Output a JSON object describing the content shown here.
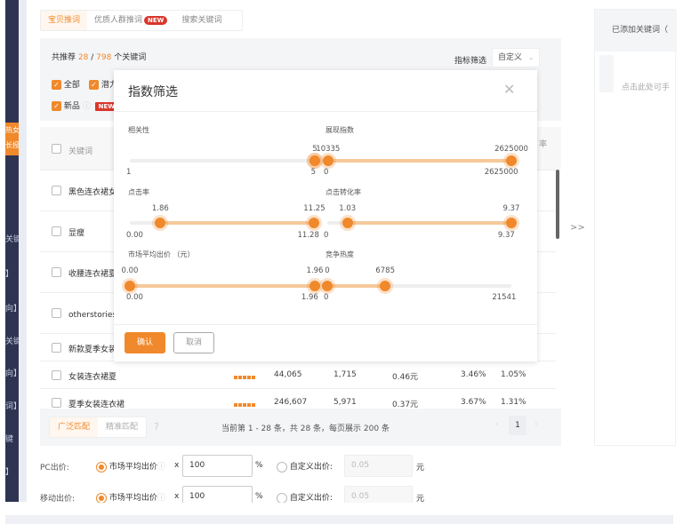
{
  "sidebar": {
    "active_text": "热女\n长授",
    "fragments": [
      "关键",
      "】",
      "向】",
      "关键",
      "向】",
      "词】",
      "键",
      "】"
    ]
  },
  "tabs": [
    {
      "label": "宝贝推词",
      "active": true
    },
    {
      "label": "优质人群推词",
      "badge": "NEW"
    },
    {
      "label": "搜索关键词"
    }
  ],
  "filter": {
    "prefix": "共推荐",
    "count": "28",
    "sep": "/",
    "total": "798",
    "suffix": "个关键词",
    "metric_label": "指标筛选",
    "metric_value": "自定义",
    "checkboxes": [
      {
        "label": "全部",
        "checked": true
      },
      {
        "label": "潜力",
        "checked": true
      },
      {
        "label": "新品",
        "checked": true,
        "badge": "NEW"
      }
    ]
  },
  "table": {
    "header_keyword": "关键词",
    "header_tail": "率",
    "rows": [
      {
        "keyword": "黑色连衣裙女"
      },
      {
        "keyword": "显瘦"
      },
      {
        "keyword": "收腰连衣裙夏"
      },
      {
        "keyword": "otherstories连"
      },
      {
        "keyword": "新款夏季女装"
      },
      {
        "keyword": "女装连衣裙夏",
        "impressions": "44,065",
        "clicks": "1,715",
        "price": "0.46元",
        "ctr": "3.46%",
        "cvr": "1.05%"
      },
      {
        "keyword": "夏季女装连衣裙",
        "impressions": "246,607",
        "clicks": "5,971",
        "price": "0.37元",
        "ctr": "3.67%",
        "cvr": "1.31%"
      }
    ]
  },
  "footer": {
    "match_broad": "广泛匹配",
    "match_exact": "精准匹配",
    "pagination_text": "当前第 1 - 28 条，共 28 条，每页展示 200 条",
    "page": "1"
  },
  "right_panel": {
    "title": "已添加关键词（",
    "hint": "点击此处可手",
    "arrow": ">>"
  },
  "bid": {
    "pc": {
      "label": "PC出价:",
      "option1": "市场平均出价",
      "times": "x",
      "value": "100",
      "unit": "%",
      "option2": "自定义出价:",
      "custom_placeholder": "0.05",
      "currency": "元"
    },
    "mobile": {
      "label": "移动出价:",
      "option1": "市场平均出价",
      "times": "x",
      "value": "100",
      "unit": "%",
      "option2": "自定义出价:",
      "custom_placeholder": "0.05",
      "currency": "元"
    }
  },
  "modal": {
    "title": "指数筛选",
    "confirm": "确认",
    "cancel": "取消",
    "sliders": [
      {
        "label": "相关性",
        "min": "1",
        "max": "5",
        "low": "5",
        "high": "5",
        "range": [
          1,
          5
        ],
        "values": [
          5,
          5
        ]
      },
      {
        "label": "展现指数",
        "min": "0",
        "max": "2625000",
        "low": "10335",
        "high": "2625000",
        "range": [
          0,
          2625000
        ],
        "values": [
          10335,
          2625000
        ]
      },
      {
        "label": "点击率",
        "min": "0.00",
        "max": "11.28",
        "low": "1.86",
        "high": "11.25",
        "range": [
          0,
          11.28
        ],
        "values": [
          1.86,
          11.25
        ]
      },
      {
        "label": "点击转化率",
        "min": "0",
        "max": "9.37",
        "low": "1.03",
        "high": "9.37",
        "range": [
          0,
          9.37
        ],
        "values": [
          1.03,
          9.37
        ]
      },
      {
        "label": "市场平均出价 （元）",
        "min": "0.00",
        "max": "1.96",
        "low": "0.00",
        "high": "1.96",
        "range": [
          0,
          1.96
        ],
        "values": [
          0,
          1.96
        ]
      },
      {
        "label": "竞争热度",
        "min": "0",
        "max": "21541",
        "low": "0",
        "high": "6785",
        "range": [
          0,
          21541
        ],
        "values": [
          0,
          6785
        ]
      }
    ]
  },
  "colors": {
    "accent": "#f0892b",
    "sidebar": "#2e3452",
    "badge": "#d9362b"
  }
}
